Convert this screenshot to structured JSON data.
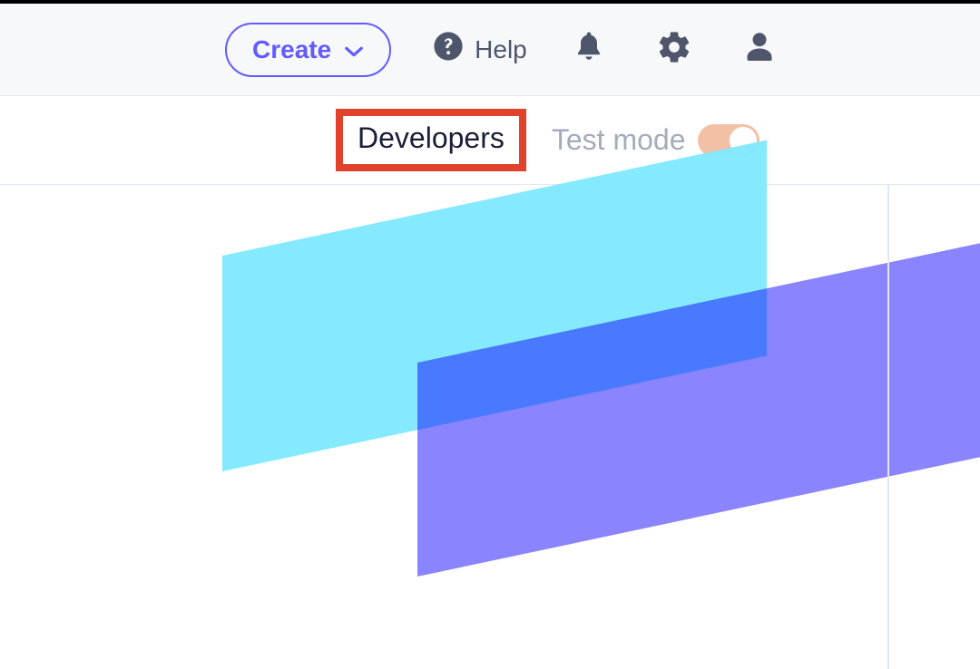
{
  "topbar": {
    "create_label": "Create",
    "help_label": "Help"
  },
  "subbar": {
    "developers_label": "Developers",
    "testmode_label": "Test mode",
    "testmode_on": true
  },
  "colors": {
    "accent": "#635bff",
    "highlight_box": "#e1422c",
    "toggle_track": "#f2c1a5",
    "stripe_cyan": "#80e9ff",
    "stripe_purple": "#7a73ff"
  }
}
